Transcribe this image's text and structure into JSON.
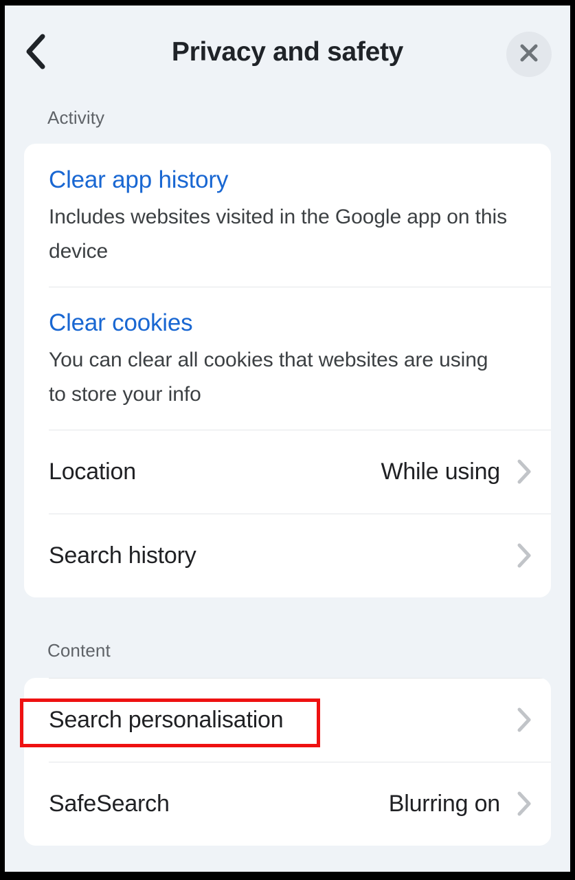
{
  "window": {
    "frame_color": "#000000",
    "background_color": "#eff3f7"
  },
  "header": {
    "title": "Privacy and safety",
    "back_icon": "chevron-left-icon",
    "close_icon": "close-icon",
    "close_button_bg": "#e3e7ec"
  },
  "annotation": {
    "color": "#ee1111",
    "target": "Search personalisation"
  },
  "sections": [
    {
      "label": "Activity",
      "rows": [
        {
          "type": "stacked",
          "title": "Clear app history",
          "title_color": "#1967d2",
          "description": "Includes websites visited in the Google app on this device"
        },
        {
          "type": "stacked",
          "title": "Clear cookies",
          "title_color": "#1967d2",
          "description": "You can clear all cookies that websites are using to store your info"
        },
        {
          "type": "simple",
          "title": "Location",
          "value": "While using",
          "chevron": "chevron-right-icon"
        },
        {
          "type": "simple",
          "title": "Search history",
          "value": "",
          "chevron": "chevron-right-icon"
        }
      ]
    },
    {
      "label": "Content",
      "rows": [
        {
          "type": "simple",
          "title": "Search personalisation",
          "value": "",
          "chevron": "chevron-right-icon",
          "highlighted": true
        },
        {
          "type": "simple",
          "title": "SafeSearch",
          "value": "Blurring on",
          "chevron": "chevron-right-icon"
        }
      ]
    }
  ]
}
